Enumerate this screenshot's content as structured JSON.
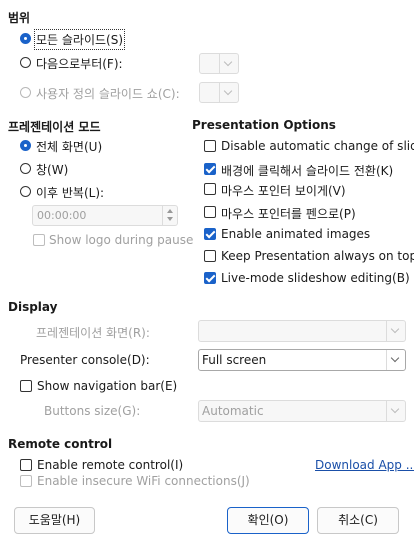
{
  "range": {
    "heading": "범위",
    "all_slides": "모든 슬라이드(S)",
    "from": "다음으로부터(F):",
    "custom_show": "사용자 정의 슬라이드 쇼(C):"
  },
  "mode": {
    "heading": "프레젠테이션 모드",
    "full_screen": "전체 화면(U)",
    "window": "창(W)",
    "loop": "이후 반복(L):",
    "loop_time": "00:00:00",
    "show_logo": "Show logo during pause"
  },
  "options": {
    "heading": "Presentation Options",
    "items": [
      {
        "label": "Disable automatic change of slides",
        "checked": false
      },
      {
        "label": "배경에 클릭해서 슬라이드 전환(K)",
        "checked": true
      },
      {
        "label": "마우스 포인터 보이게(V)",
        "checked": false
      },
      {
        "label": "마우스 포인터를 펜으로(P)",
        "checked": false
      },
      {
        "label": "Enable animated images",
        "checked": true
      },
      {
        "label": "Keep Presentation always on top",
        "checked": false
      },
      {
        "label": "Live-mode slideshow editing(B)",
        "checked": true
      }
    ]
  },
  "display": {
    "heading": "Display",
    "presentation_screen_label": "프레젠테이션 화면(R):",
    "presentation_screen_value": "",
    "presenter_console_label": "Presenter console(D):",
    "presenter_console_value": "Full screen",
    "show_nav_bar": "Show navigation bar(E)",
    "buttons_size_label": "Buttons size(G):",
    "buttons_size_value": "Automatic"
  },
  "remote": {
    "heading": "Remote control",
    "enable": "Enable remote control(I)",
    "insecure_wifi": "Enable insecure WiFi connections(J)",
    "download_link": "Download App ..."
  },
  "buttons": {
    "help": "도움말(H)",
    "ok": "확인(O)",
    "cancel": "취소(C)"
  },
  "colors": {
    "accent": "#1a62c9",
    "link": "#1a4fa8"
  }
}
